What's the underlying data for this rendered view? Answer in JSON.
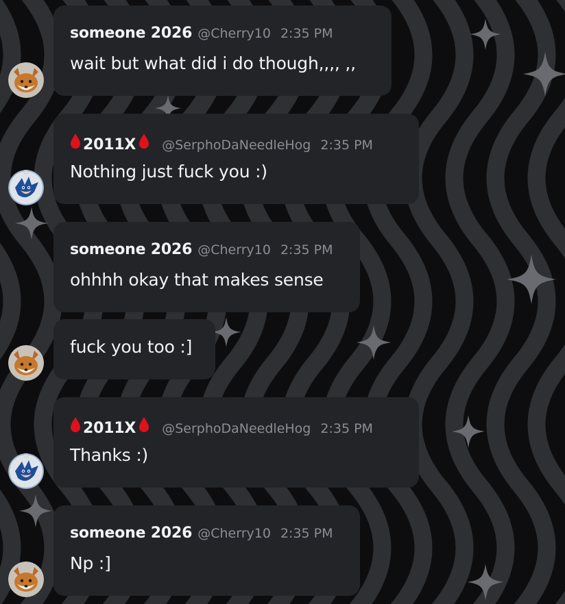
{
  "theme": {
    "background": "#0d0d0f",
    "bubble": "#232428",
    "text": "#f2f3f5",
    "muted": "#8b8d93",
    "drop": "#e0111b"
  },
  "users": {
    "cherry": {
      "display_name": "someone 2026",
      "handle": "@Cherry10",
      "avatar_icon": "fox-avatar-icon"
    },
    "serpho": {
      "display_name": "2011X",
      "handle": "@SerphoDaNeedleHog",
      "avatar_icon": "blue-hedgehog-avatar-icon",
      "name_decoration": "blood-drop-icon"
    }
  },
  "messages": [
    {
      "author": "someone 2026",
      "handle": "@Cherry10",
      "time": "2:35 PM",
      "text": "wait but what did i do though,,,, ,,"
    },
    {
      "author": "2011X",
      "handle": "@SerphoDaNeedleHog",
      "time": "2:35 PM",
      "text": "Nothing just fuck you :)"
    },
    {
      "author": "someone 2026",
      "handle": "@Cherry10",
      "time": "2:35 PM",
      "text": "ohhhh okay that makes sense"
    },
    {
      "text": "fuck you too :]"
    },
    {
      "author": "2011X",
      "handle": "@SerphoDaNeedleHog",
      "time": "2:35 PM",
      "text": "Thanks :)"
    },
    {
      "author": "someone 2026",
      "handle": "@Cherry10",
      "time": "2:35 PM",
      "text": "Np :]"
    }
  ]
}
